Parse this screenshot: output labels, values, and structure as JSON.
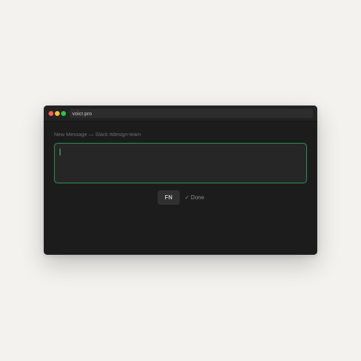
{
  "window": {
    "address": "voicr.pro"
  },
  "context": {
    "label": "New Message — Slack #design-team"
  },
  "message": {
    "value": ""
  },
  "controls": {
    "fn_label": "FN",
    "done_label": "✓ Done"
  },
  "colors": {
    "background": "#f3f2ef",
    "window": "#1c1c1c",
    "focus_border": "#2f8a55",
    "caret": "#3fcf7b",
    "close": "#ff5f57",
    "minimize": "#febc2e",
    "maximize": "#28c840"
  }
}
